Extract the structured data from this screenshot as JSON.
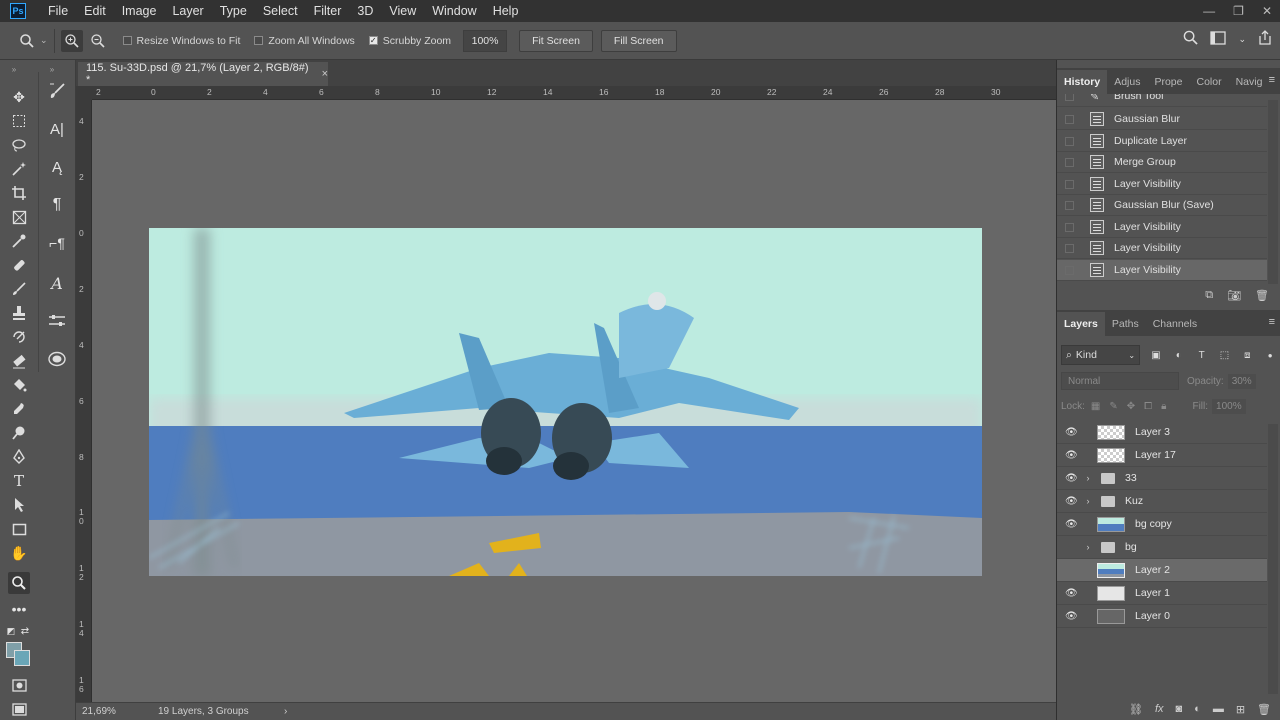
{
  "app": {
    "logo": "Ps"
  },
  "menu": [
    "File",
    "Edit",
    "Image",
    "Layer",
    "Type",
    "Select",
    "Filter",
    "3D",
    "View",
    "Window",
    "Help"
  ],
  "options": {
    "resize_windows": "Resize Windows to Fit",
    "zoom_all": "Zoom All Windows",
    "scrubby_zoom": "Scrubby Zoom",
    "zoom_value": "100%",
    "fit_screen": "Fit Screen",
    "fill_screen": "Fill Screen"
  },
  "document": {
    "tab_title": "115. Su-33D.psd @ 21,7% (Layer 2, RGB/8#) *",
    "close": "×"
  },
  "ruler": {
    "top": [
      "2",
      "0",
      "2",
      "4",
      "6",
      "8",
      "10",
      "12",
      "14",
      "16",
      "18",
      "20",
      "22",
      "24",
      "26",
      "28",
      "30"
    ],
    "left": [
      "4",
      "2",
      "0",
      "2",
      "4",
      "6",
      "8",
      "1 0",
      "1 2",
      "1 4",
      "1 6"
    ]
  },
  "status": {
    "zoom": "21,69%",
    "info": "19 Layers, 3 Groups"
  },
  "history": {
    "tabs": [
      "History",
      "Adjus",
      "Prope",
      "Color",
      "Navig"
    ],
    "items": [
      "Brush Tool",
      "Gaussian Blur",
      "Duplicate Layer",
      "Merge Group",
      "Layer Visibility",
      "Gaussian Blur (Save)",
      "Layer Visibility",
      "Layer Visibility",
      "Layer Visibility"
    ]
  },
  "layers": {
    "tabs": [
      "Layers",
      "Paths",
      "Channels"
    ],
    "filter_kind": "Kind",
    "blend_mode": "Normal",
    "opacity_label": "Opacity:",
    "opacity_value": "30%",
    "lock_label": "Lock:",
    "fill_label": "Fill:",
    "fill_value": "100%",
    "items": [
      {
        "name": "Layer 3",
        "visible": true
      },
      {
        "name": "Layer 17",
        "visible": true
      },
      {
        "name": "33",
        "visible": true
      },
      {
        "name": "Kuz",
        "visible": true
      },
      {
        "name": "bg copy",
        "visible": true
      },
      {
        "name": "bg",
        "visible": false
      },
      {
        "name": "Layer 2",
        "visible": false
      },
      {
        "name": "Layer 1",
        "visible": true
      },
      {
        "name": "Layer 0",
        "visible": true
      }
    ]
  },
  "colors": {
    "foreground": "#7f9fa8",
    "background": "#6aa6b7",
    "sky": "#bdebe0",
    "sea": "#4f7dbf",
    "deck": "#8f97a2",
    "jet": "#6aaed6"
  }
}
